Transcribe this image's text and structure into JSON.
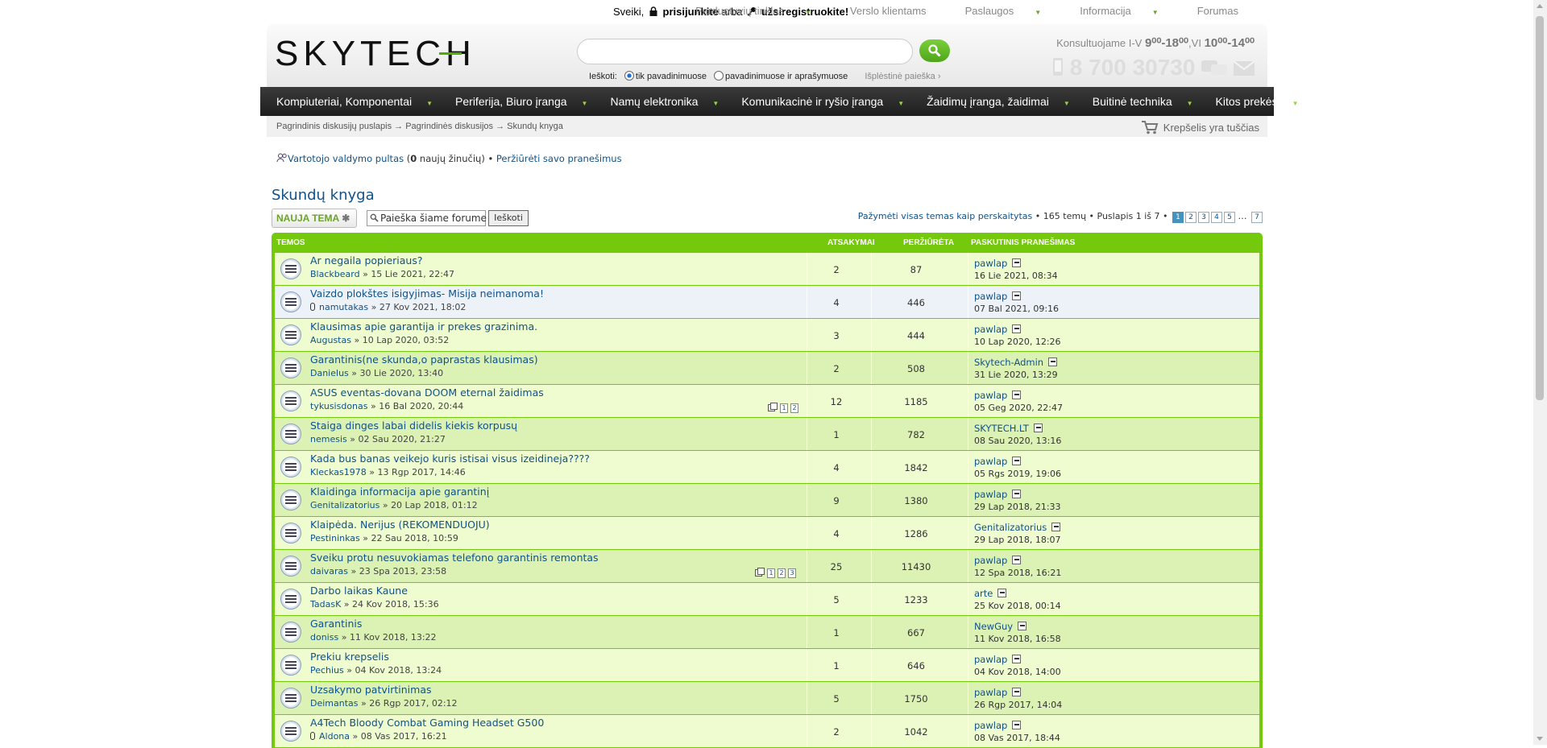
{
  "topbar": {
    "greet_prefix": "Sveiki,",
    "login": "prisijunkite",
    "or": "arba",
    "register": "užsiregistruokite!",
    "links": [
      "Parduotuvių tinklas",
      "Verslo klientams",
      "Paslaugos",
      "Informacija",
      "Forumas"
    ]
  },
  "header": {
    "logo": "SKYTECH",
    "search_label": "Ieškoti:",
    "opt1": "tik pavadinimuose",
    "opt2": "pavadinimuose ir aprašymuose",
    "advanced": "Išplėstinė paieška ›",
    "consult_text": "Konsultuojame I-V",
    "consult_hours1": "9⁰⁰-18⁰⁰",
    "consult_sat": ",VI",
    "consult_hours2": "10⁰⁰-14⁰⁰",
    "phone": "8 700 30730"
  },
  "nav": [
    "Kompiuteriai, Komponentai",
    "Periferija, Biuro įranga",
    "Namų elektronika",
    "Komunikacinė ir ryšio įranga",
    "Žaidimų įranga, žaidimai",
    "Buitinė technika",
    "Kitos prekės"
  ],
  "breadcrumb": "Pagrindinis diskusijų puslapis → Pagrindinės diskusijos → Skundų knyga",
  "cart": "Krepšelis yra tuščias",
  "ucp": {
    "panel": "Vartotojo valdymo pultas",
    "msgs_prefix": " (",
    "msgs_count": "0",
    "msgs_suffix": " naujų žinučių) • ",
    "view_posts": "Peržiūrėti savo pranešimus"
  },
  "forum": {
    "title": "Skundų knyga",
    "new_topic": "NAUJA TEMA",
    "search_placeholder": "Paieška šiame forume",
    "search_btn": "Ieškoti",
    "mark_read": "Pažymėti visas temas kaip perskaitytas",
    "topic_count": " • 165 temų • Puslapis ",
    "page_cur": "1",
    "page_of": " iš 7 • ",
    "pages": [
      "1",
      "2",
      "3",
      "4",
      "5"
    ],
    "dots": " … ",
    "last_page": "7",
    "headers": {
      "topics": "TEMOS",
      "replies": "ATSAKYMAI",
      "views": "PERŽIŪRĖTA",
      "last": "PASKUTINIS PRANEŠIMAS"
    }
  },
  "topics": [
    {
      "title": "Ar negaila popieriaus?",
      "author": "Blackbeard",
      "date": "15 Lie 2021, 22:47",
      "replies": "2",
      "views": "87",
      "last_user": "pawlap",
      "last_date": "16 Lie 2021, 08:34"
    },
    {
      "title": "Vaizdo plokštes isigyjimas- Misija neimanoma!",
      "author": "namutakas",
      "date": "27 Kov 2021, 18:02",
      "replies": "4",
      "views": "446",
      "last_user": "pawlap",
      "last_date": "07 Bal 2021, 09:16",
      "attach": true
    },
    {
      "title": "Klausimas apie garantija ir prekes grazinima.",
      "author": "Augustas",
      "date": "10 Lap 2020, 03:52",
      "replies": "3",
      "views": "444",
      "last_user": "pawlap",
      "last_date": "10 Lap 2020, 12:26"
    },
    {
      "title": "Garantinis(ne skunda,o paprastas klausimas)",
      "author": "Danielus",
      "date": "30 Lie 2020, 13:40",
      "replies": "2",
      "views": "508",
      "last_user": "Skytech-Admin",
      "last_date": "31 Lie 2020, 13:29"
    },
    {
      "title": "ASUS eventas-dovana DOOM eternal žaidimas",
      "author": "tykusisdonas",
      "date": "16 Bal 2020, 20:44",
      "replies": "12",
      "views": "1185",
      "last_user": "pawlap",
      "last_date": "05 Geg 2020, 22:47",
      "pages": [
        "1",
        "2"
      ]
    },
    {
      "title": "Staiga dinges labai didelis kiekis korpusų",
      "author": "nemesis",
      "date": "02 Sau 2020, 21:27",
      "replies": "1",
      "views": "782",
      "last_user": "SKYTECH.LT",
      "last_date": "08 Sau 2020, 13:16"
    },
    {
      "title": "Kada bus banas veikejo kuris istisai visus izeidineja????",
      "author": "Kleckas1978",
      "date": "13 Rgp 2017, 14:46",
      "replies": "4",
      "views": "1842",
      "last_user": "pawlap",
      "last_date": "05 Rgs 2019, 19:06"
    },
    {
      "title": "Klaidinga informacija apie garantinį",
      "author": "Genitalizatorius",
      "date": "20 Lap 2018, 01:12",
      "replies": "9",
      "views": "1380",
      "last_user": "pawlap",
      "last_date": "29 Lap 2018, 21:33"
    },
    {
      "title": "Klaipėda. Nerijus (REKOMENDUOJU)",
      "author": "Pestininkas",
      "date": "22 Sau 2018, 10:59",
      "replies": "4",
      "views": "1286",
      "last_user": "Genitalizatorius",
      "last_date": "29 Lap 2018, 18:07"
    },
    {
      "title": "Sveiku protu nesuvokiamas telefono garantinis remontas",
      "author": "daivaras",
      "date": "23 Spa 2013, 23:58",
      "replies": "25",
      "views": "11430",
      "last_user": "pawlap",
      "last_date": "12 Spa 2018, 16:21",
      "pages": [
        "1",
        "2",
        "3"
      ]
    },
    {
      "title": "Darbo laikas Kaune",
      "author": "TadasK",
      "date": "24 Kov 2018, 15:36",
      "replies": "5",
      "views": "1233",
      "last_user": "arte",
      "last_date": "25 Kov 2018, 00:14"
    },
    {
      "title": "Garantinis",
      "author": "doniss",
      "date": "11 Kov 2018, 13:22",
      "replies": "1",
      "views": "667",
      "last_user": "NewGuy",
      "last_date": "11 Kov 2018, 16:58"
    },
    {
      "title": "Prekiu krepselis",
      "author": "Pechius",
      "date": "04 Kov 2018, 13:24",
      "replies": "1",
      "views": "646",
      "last_user": "pawlap",
      "last_date": "04 Kov 2018, 14:00"
    },
    {
      "title": "Uzsakymo patvirtinimas",
      "author": "Deimantas",
      "date": "26 Rgp 2017, 02:12",
      "replies": "5",
      "views": "1750",
      "last_user": "pawlap",
      "last_date": "26 Rgp 2017, 14:04"
    },
    {
      "title": "A4Tech Bloody Combat Gaming Headset G500",
      "author": "Aldona",
      "date": "08 Vas 2017, 16:21",
      "replies": "2",
      "views": "1042",
      "last_user": "pawlap",
      "last_date": "08 Vas 2017, 18:44",
      "attach": true
    }
  ]
}
